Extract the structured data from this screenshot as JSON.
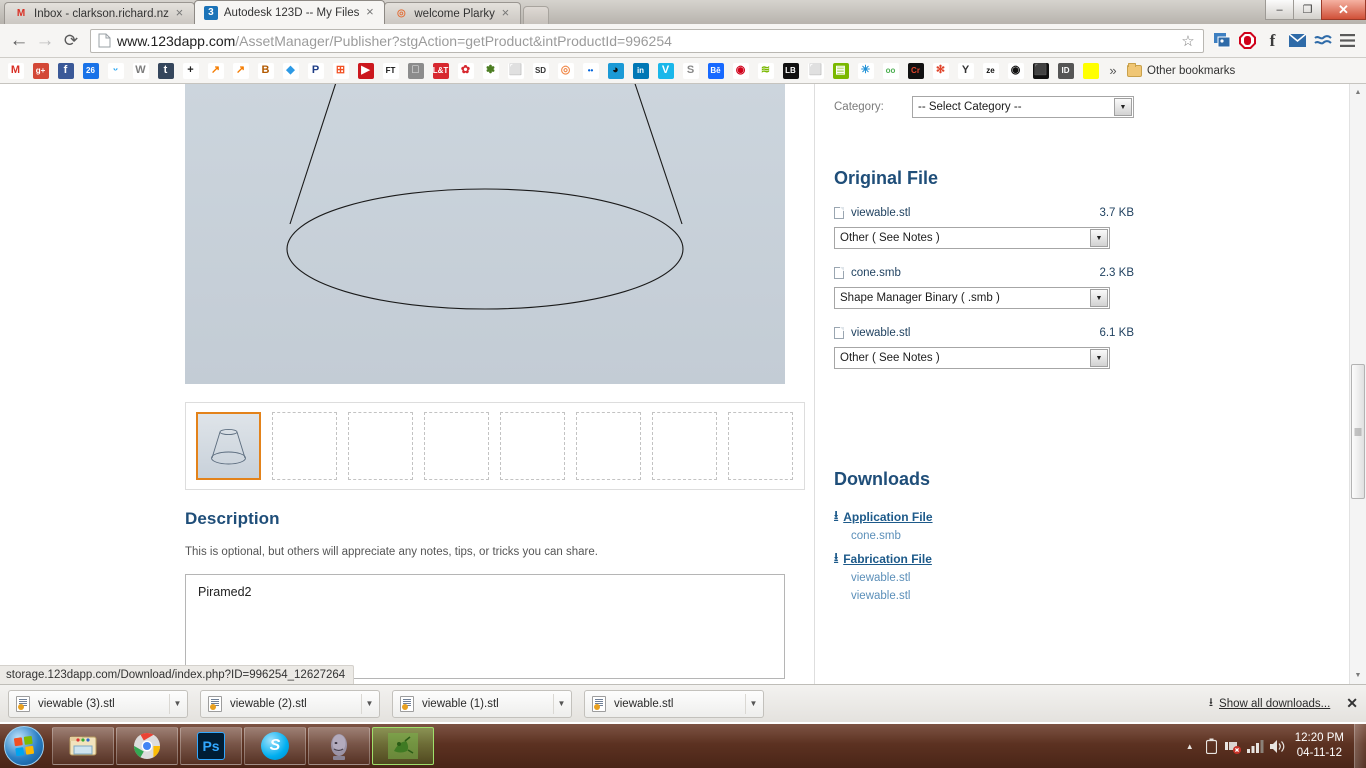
{
  "browser": {
    "tabs": [
      {
        "title": "Inbox - clarkson.richard.nz",
        "favicon": "gmail-icon",
        "active": false
      },
      {
        "title": "Autodesk 123D -- My Files",
        "favicon": "autodesk-123d-icon",
        "active": true
      },
      {
        "title": "welcome Plarky",
        "favicon": "plarky-icon",
        "active": false
      }
    ],
    "window_controls": {
      "minimize": "–",
      "maximize": "❐",
      "close": "✕"
    },
    "nav": {
      "back": "←",
      "forward": "→",
      "reload": "⟳"
    },
    "url": {
      "host": "www.123dapp.com",
      "path": "/AssetManager/Publisher?stgAction=getProduct&intProductId=996254",
      "full": "www.123dapp.com/AssetManager/Publisher?stgAction=getProduct&intProductId=996254"
    },
    "bookmark_star": "star-icon",
    "toolbar_extensions": [
      "image-stack-icon",
      "adblock-icon",
      "facebook-icon",
      "mail-icon",
      "feedly-icon",
      "chrome-menu-icon"
    ],
    "bookmarks": [
      {
        "name": "gmail-icon",
        "glyph": "M",
        "bg": "#ffffff",
        "fg": "#d93025"
      },
      {
        "name": "google-plus-icon",
        "glyph": "g+",
        "bg": "#d34836",
        "fg": "#ffffff"
      },
      {
        "name": "facebook-icon",
        "glyph": "f",
        "bg": "#3b5998",
        "fg": "#ffffff"
      },
      {
        "name": "calendar-icon",
        "glyph": "26",
        "bg": "#1a73e8",
        "fg": "#ffffff"
      },
      {
        "name": "twitter-icon",
        "glyph": "ᵕ",
        "bg": "#ffffff",
        "fg": "#1da1f2"
      },
      {
        "name": "wordpress-icon",
        "glyph": "W",
        "bg": "#ffffff",
        "fg": "#7d7d7d"
      },
      {
        "name": "tumblr-icon",
        "glyph": "t",
        "bg": "#35465c",
        "fg": "#ffffff"
      },
      {
        "name": "plus-icon",
        "glyph": "+",
        "bg": "#ffffff",
        "fg": "#222222"
      },
      {
        "name": "analytics-icon",
        "glyph": "↗",
        "bg": "#ffffff",
        "fg": "#f57c00"
      },
      {
        "name": "analytics-b-icon",
        "glyph": "↗",
        "bg": "#ffffff",
        "fg": "#f57c00"
      },
      {
        "name": "b-icon",
        "glyph": "B",
        "bg": "#ffffff",
        "fg": "#b35a00"
      },
      {
        "name": "dropbox-icon",
        "glyph": "◆",
        "bg": "#ffffff",
        "fg": "#2d9ae5"
      },
      {
        "name": "paypal-icon",
        "glyph": "P",
        "bg": "#ffffff",
        "fg": "#1d3c85"
      },
      {
        "name": "windows-icon",
        "glyph": "⊞",
        "bg": "#ffffff",
        "fg": "#f25022"
      },
      {
        "name": "youtube-icon",
        "glyph": "▶",
        "bg": "#cc181e",
        "fg": "#ffffff"
      },
      {
        "name": "financial-times-icon",
        "glyph": "FT",
        "bg": "#ffffff",
        "fg": "#111111"
      },
      {
        "name": "apple-icon",
        "glyph": "",
        "bg": "#8c8c8c",
        "fg": "#ffffff"
      },
      {
        "name": "lordandtaylor-icon",
        "glyph": "L&T",
        "bg": "#d7282f",
        "fg": "#ffffff"
      },
      {
        "name": "flower-icon",
        "glyph": "✿",
        "bg": "#ffffff",
        "fg": "#d7282f"
      },
      {
        "name": "frog-icon",
        "glyph": "✽",
        "bg": "#ffffff",
        "fg": "#4a7c20"
      },
      {
        "name": "document-icon",
        "glyph": "⬜",
        "bg": "#ffffff",
        "fg": "#777777"
      },
      {
        "name": "sd-icon",
        "glyph": "SD",
        "bg": "#ffffff",
        "fg": "#333333"
      },
      {
        "name": "adobe-icon",
        "glyph": "◎",
        "bg": "#ffffff",
        "fg": "#f08a4b"
      },
      {
        "name": "flickr-icon",
        "glyph": "••",
        "bg": "#ffffff",
        "fg": "#0063dc"
      },
      {
        "name": "circle-dark-icon",
        "glyph": "◕",
        "bg": "#1b9ad6",
        "fg": "#111111"
      },
      {
        "name": "linkedin-icon",
        "glyph": "in",
        "bg": "#0077b5",
        "fg": "#ffffff"
      },
      {
        "name": "vimeo-icon",
        "glyph": "V",
        "bg": "#1ab7ea",
        "fg": "#ffffff"
      },
      {
        "name": "scribd-icon",
        "glyph": "S",
        "bg": "#ffffff",
        "fg": "#888888"
      },
      {
        "name": "behance-icon",
        "glyph": "Bē",
        "bg": "#1769ff",
        "fg": "#ffffff"
      },
      {
        "name": "record-icon",
        "glyph": "◉",
        "bg": "#ffffff",
        "fg": "#d0021b"
      },
      {
        "name": "wave-icon",
        "glyph": "≋",
        "bg": "#ffffff",
        "fg": "#7ab800"
      },
      {
        "name": "lb-icon",
        "glyph": "LB",
        "bg": "#111111",
        "fg": "#ffffff"
      },
      {
        "name": "blank-page-icon",
        "glyph": "⬜",
        "bg": "#ffffff",
        "fg": "#888888"
      },
      {
        "name": "green-note-icon",
        "glyph": "▤",
        "bg": "#7ab800",
        "fg": "#ffffff"
      },
      {
        "name": "star-blue-icon",
        "glyph": "✳",
        "bg": "#ffffff",
        "fg": "#1e90d6"
      },
      {
        "name": "oo-icon",
        "glyph": "oo",
        "bg": "#ffffff",
        "fg": "#4caf50"
      },
      {
        "name": "cr-icon",
        "glyph": "Cr",
        "bg": "#111111",
        "fg": "#e0452c"
      },
      {
        "name": "color-wheel-icon",
        "glyph": "✻",
        "bg": "#ffffff",
        "fg": "#e0452c"
      },
      {
        "name": "y-icon",
        "glyph": "Y",
        "bg": "#ffffff",
        "fg": "#333333"
      },
      {
        "name": "zeen-icon",
        "glyph": "ze",
        "bg": "#ffffff",
        "fg": "#111111"
      },
      {
        "name": "eye-icon",
        "glyph": "◉",
        "bg": "#ffffff",
        "fg": "#111111"
      },
      {
        "name": "tablet-icon",
        "glyph": "⬛",
        "bg": "#111111",
        "fg": "#ffffff"
      },
      {
        "name": "id-icon",
        "glyph": "ID",
        "bg": "#555555",
        "fg": "#ffffff"
      },
      {
        "name": "yellow-icon",
        "glyph": "",
        "bg": "#ffff00",
        "fg": "#ffff00"
      }
    ],
    "bookmarks_overflow": "»",
    "other_bookmarks": "Other bookmarks"
  },
  "page": {
    "category": {
      "label": "Category:",
      "value": "-- Select Category --"
    },
    "viewer": {
      "name": "cone-3d-preview"
    },
    "thumbnails": {
      "count": 8,
      "selected_index": 0
    },
    "original_file": {
      "heading": "Original File",
      "files": [
        {
          "name": "viewable.stl",
          "size": "3.7 KB",
          "type": "Other ( See Notes )"
        },
        {
          "name": "cone.smb",
          "size": "2.3 KB",
          "type": "Shape Manager Binary ( .smb )"
        },
        {
          "name": "viewable.stl",
          "size": "6.1 KB",
          "type": "Other ( See Notes )"
        }
      ]
    },
    "downloads": {
      "heading": "Downloads",
      "groups": [
        {
          "label": "Application File",
          "items": [
            "cone.smb"
          ]
        },
        {
          "label": "Fabrication File",
          "items": [
            "viewable.stl",
            "viewable.stl"
          ]
        }
      ]
    },
    "description": {
      "heading": "Description",
      "help": "This is optional, but others will appreciate any notes, tips, or tricks you can share.",
      "value": "Piramed2"
    }
  },
  "status_bubble": "storage.123dapp.com/Download/index.php?ID=996254_12627264",
  "download_shelf": {
    "items": [
      {
        "name": "viewable (3).stl"
      },
      {
        "name": "viewable (2).stl"
      },
      {
        "name": "viewable (1).stl"
      },
      {
        "name": "viewable.stl"
      }
    ],
    "show_all": "Show all downloads...",
    "close": "✕"
  },
  "taskbar": {
    "start": "windows-start-orb",
    "buttons": [
      {
        "name": "explorer-icon",
        "active": false
      },
      {
        "name": "chrome-icon",
        "active": false
      },
      {
        "name": "photoshop-icon",
        "label": "Ps",
        "active": false
      },
      {
        "name": "skype-icon",
        "label": "S",
        "active": false
      },
      {
        "name": "head-model-icon",
        "active": false
      },
      {
        "name": "autodesk-123d-icon",
        "active": true
      }
    ],
    "tray": [
      "show-hidden-icons",
      "battery-icon",
      "network-error-icon",
      "signal-icon",
      "volume-icon"
    ],
    "clock": {
      "time": "12:20 PM",
      "date": "04-11-12"
    }
  },
  "colors": {
    "heading_blue": "#1f4e79",
    "link_blue": "#1d5a8a",
    "thumb_selected": "#e3821a",
    "taskbar": "#4a2517"
  }
}
